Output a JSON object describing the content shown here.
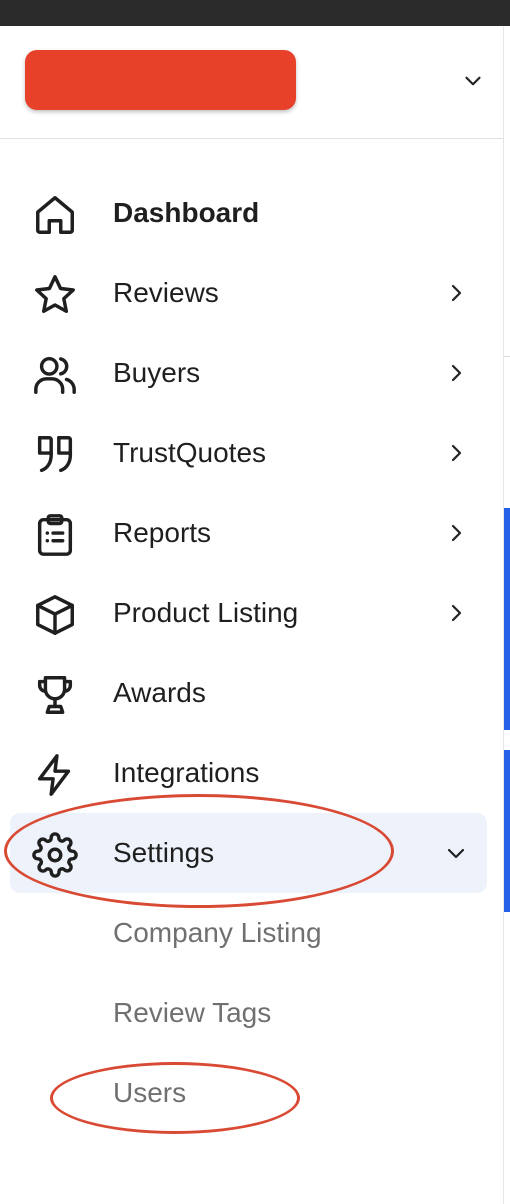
{
  "header": {
    "brand_color": "#e8412a",
    "chevron_icon": "chevron-down-icon"
  },
  "nav": {
    "items": [
      {
        "label": "Dashboard",
        "icon": "home-icon",
        "has_chevron": false,
        "bold": true
      },
      {
        "label": "Reviews",
        "icon": "star-icon",
        "has_chevron": true,
        "chevron": "chevron-right-icon"
      },
      {
        "label": "Buyers",
        "icon": "users-icon",
        "has_chevron": true,
        "chevron": "chevron-right-icon"
      },
      {
        "label": "TrustQuotes",
        "icon": "quote-icon",
        "has_chevron": true,
        "chevron": "chevron-right-icon"
      },
      {
        "label": "Reports",
        "icon": "clipboard-list-icon",
        "has_chevron": true,
        "chevron": "chevron-right-icon"
      },
      {
        "label": "Product Listing",
        "icon": "cube-icon",
        "has_chevron": true,
        "chevron": "chevron-right-icon"
      },
      {
        "label": "Awards",
        "icon": "trophy-icon",
        "has_chevron": false
      },
      {
        "label": "Integrations",
        "icon": "lightning-icon",
        "has_chevron": false
      },
      {
        "label": "Settings",
        "icon": "gear-icon",
        "has_chevron": true,
        "chevron": "chevron-down-icon",
        "active": true,
        "expanded": true
      }
    ],
    "settings_submenu": [
      {
        "label": "Company Listing"
      },
      {
        "label": "Review Tags"
      },
      {
        "label": "Users"
      }
    ]
  },
  "colors": {
    "active_background": "#eef3fb",
    "annotation_red": "#d94a35",
    "submenu_text": "#707070"
  }
}
